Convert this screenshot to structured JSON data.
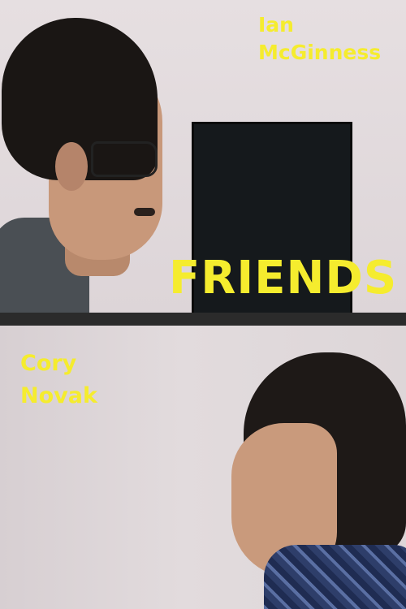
{
  "poster": {
    "title": "FRIENDS",
    "top_credit": {
      "first": "Ian",
      "last": "McGinness"
    },
    "bottom_credit": {
      "first": "Cory",
      "last": "Novak"
    }
  },
  "colors": {
    "text": "#f5ec2e",
    "divider": "#2b2b2b",
    "wall": "#e2dbdd"
  }
}
